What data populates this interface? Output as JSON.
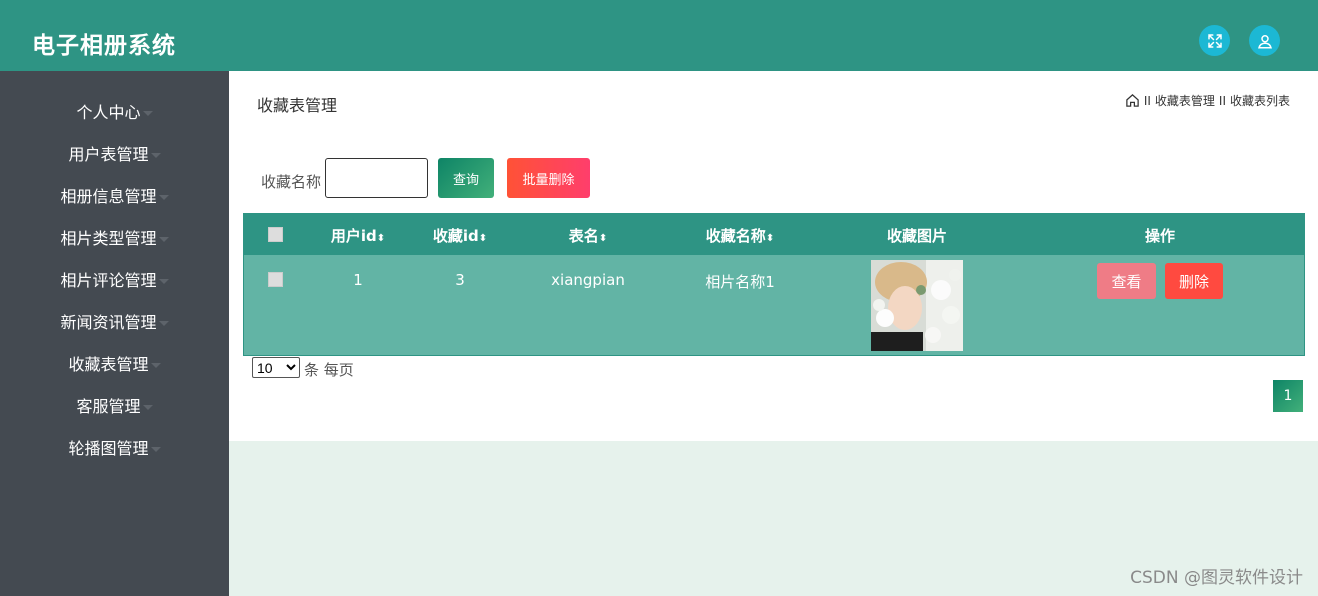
{
  "app": {
    "title": "电子相册系统"
  },
  "topbar": {
    "icons": [
      "fullscreen-icon",
      "user-icon"
    ],
    "color": "#2e9484",
    "icon_color": "#1cb8d4"
  },
  "sidebar": {
    "items": [
      {
        "label": "个人中心"
      },
      {
        "label": "用户表管理"
      },
      {
        "label": "相册信息管理"
      },
      {
        "label": "相片类型管理"
      },
      {
        "label": "相片评论管理"
      },
      {
        "label": "新闻资讯管理"
      },
      {
        "label": "收藏表管理"
      },
      {
        "label": "客服管理"
      },
      {
        "label": "轮播图管理"
      }
    ]
  },
  "page": {
    "title": "收藏表管理",
    "breadcrumb": {
      "sep1": "II",
      "part1": "收藏表管理",
      "sep2": "II",
      "part2": "收藏表列表"
    }
  },
  "search": {
    "label": "收藏名称",
    "value": "",
    "query_label": "查询",
    "batch_delete_label": "批量删除"
  },
  "table": {
    "columns": [
      "用户id",
      "收藏id",
      "表名",
      "收藏名称",
      "收藏图片",
      "操作"
    ],
    "sort_glyph": "⬍",
    "rows": [
      {
        "user_id": "1",
        "fav_id": "3",
        "table_name": "xiangpian",
        "fav_name": "相片名称1",
        "view_label": "查看",
        "delete_label": "删除"
      }
    ]
  },
  "pagination": {
    "page_size": "10",
    "page_size_options": [
      "10"
    ],
    "page_size_label": "条 每页",
    "current_page": "1"
  },
  "watermark": "CSDN @图灵软件设计"
}
